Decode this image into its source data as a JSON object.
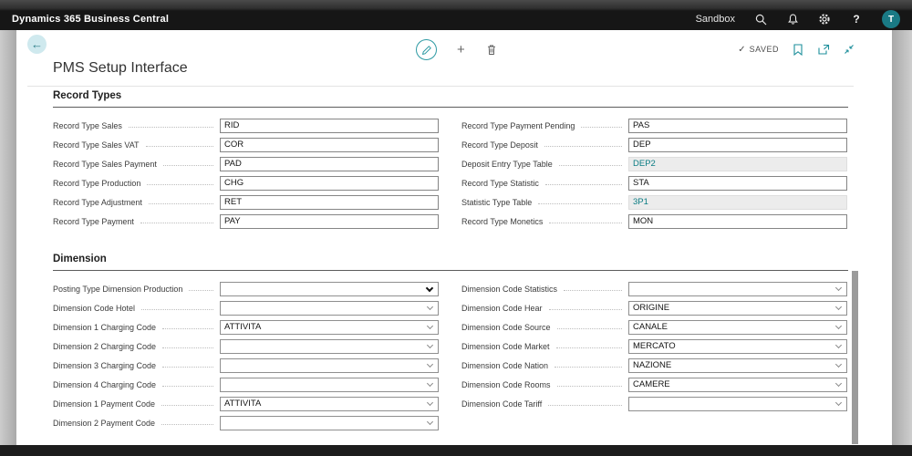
{
  "colors": {
    "accent_teal": "#1d8f9b",
    "link_teal": "#0b7d84",
    "avatar_teal": "#1a7a85",
    "topbar_black": "#161616"
  },
  "topbar": {
    "app_title": "Dynamics 365 Business Central",
    "environment": "Sandbox",
    "help_label": "?",
    "avatar_initial": "T"
  },
  "toolbar": {
    "back_glyph": "←",
    "plus_glyph": "+",
    "saved_check": "✓",
    "saved_label": "SAVED"
  },
  "page": {
    "title": "PMS Setup Interface"
  },
  "sections": [
    {
      "title": "Record Types",
      "left": [
        {
          "label": "Record Type Sales",
          "value": "RID",
          "control": "textbox"
        },
        {
          "label": "Record Type Sales VAT",
          "value": "COR",
          "control": "textbox"
        },
        {
          "label": "Record Type Sales Payment",
          "value": "PAD",
          "control": "textbox"
        },
        {
          "label": "Record Type Production",
          "value": "CHG",
          "control": "textbox"
        },
        {
          "label": "Record Type Adjustment",
          "value": "RET",
          "control": "textbox"
        },
        {
          "label": "Record Type Payment",
          "value": "PAY",
          "control": "textbox"
        }
      ],
      "right": [
        {
          "label": "Record Type Payment Pending",
          "value": "PAS",
          "control": "textbox"
        },
        {
          "label": "Record Type Deposit",
          "value": "DEP",
          "control": "textbox"
        },
        {
          "label": "Deposit Entry Type Table",
          "value": "DEP2",
          "control": "lookup-link"
        },
        {
          "label": "Record Type Statistic",
          "value": "STA",
          "control": "textbox"
        },
        {
          "label": "Statistic Type Table",
          "value": "3P1",
          "control": "lookup-link"
        },
        {
          "label": "Record Type Monetics",
          "value": "MON",
          "control": "textbox"
        }
      ]
    },
    {
      "title": "Dimension",
      "left": [
        {
          "label": "Posting Type Dimension Production",
          "value": "",
          "control": "dropdown-open"
        },
        {
          "label": "Dimension Code Hotel",
          "value": "",
          "control": "dropdown"
        },
        {
          "label": "Dimension 1 Charging Code",
          "value": "ATTIVITA",
          "control": "dropdown"
        },
        {
          "label": "Dimension 2 Charging Code",
          "value": "",
          "control": "dropdown"
        },
        {
          "label": "Dimension 3 Charging Code",
          "value": "",
          "control": "dropdown"
        },
        {
          "label": "Dimension 4 Charging Code",
          "value": "",
          "control": "dropdown"
        },
        {
          "label": "Dimension 1 Payment Code",
          "value": "ATTIVITA",
          "control": "dropdown"
        },
        {
          "label": "Dimension 2 Payment Code",
          "value": "",
          "control": "dropdown"
        }
      ],
      "right": [
        {
          "label": "Dimension Code Statistics",
          "value": "",
          "control": "dropdown"
        },
        {
          "label": "Dimension Code Hear",
          "value": "ORIGINE",
          "control": "dropdown"
        },
        {
          "label": "Dimension Code Source",
          "value": "CANALE",
          "control": "dropdown"
        },
        {
          "label": "Dimension Code Market",
          "value": "MERCATO",
          "control": "dropdown"
        },
        {
          "label": "Dimension Code Nation",
          "value": "NAZIONE",
          "control": "dropdown"
        },
        {
          "label": "Dimension Code Rooms",
          "value": "CAMERE",
          "control": "dropdown"
        },
        {
          "label": "Dimension Code Tariff",
          "value": "",
          "control": "dropdown"
        }
      ]
    }
  ]
}
